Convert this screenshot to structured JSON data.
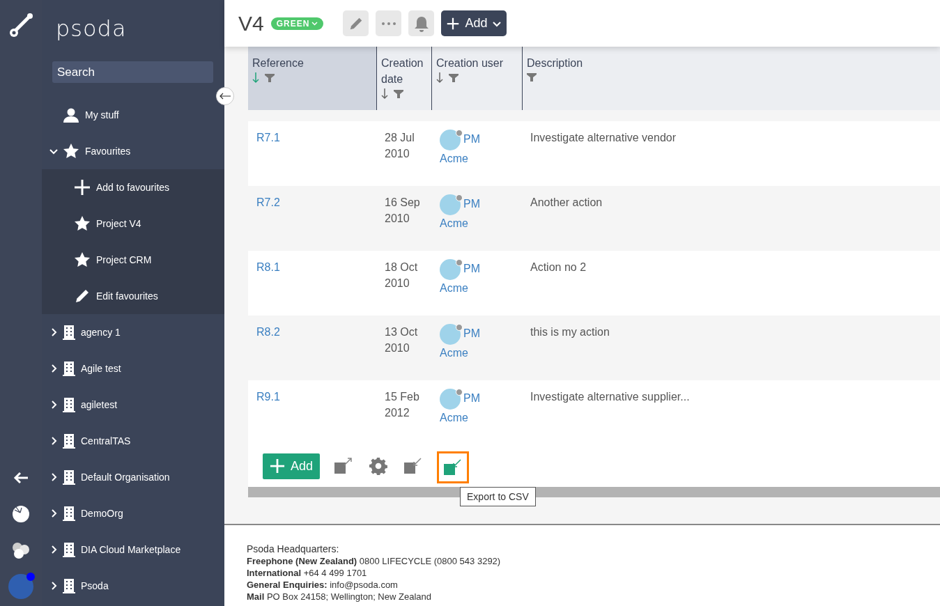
{
  "rail": {
    "notification": true
  },
  "sidebar": {
    "logo": "psoda",
    "search": {
      "placeholder": "Search"
    },
    "items": [
      {
        "label": "My stuff",
        "kind": "user"
      },
      {
        "label": "Favourites",
        "kind": "star",
        "expanded": true,
        "children": [
          {
            "label": "Add to favourites",
            "kind": "plus"
          },
          {
            "label": "Project V4",
            "kind": "star"
          },
          {
            "label": "Project CRM",
            "kind": "star"
          },
          {
            "label": "Edit favourites",
            "kind": "pencil"
          }
        ]
      },
      {
        "label": "agency 1",
        "kind": "building",
        "expanded": false
      },
      {
        "label": "Agile test",
        "kind": "building",
        "expanded": false
      },
      {
        "label": "agiletest",
        "kind": "building",
        "expanded": false
      },
      {
        "label": "CentralTAS",
        "kind": "building",
        "expanded": false
      },
      {
        "label": "Default Organisation",
        "kind": "building",
        "expanded": false
      },
      {
        "label": "DemoOrg",
        "kind": "building",
        "expanded": false
      },
      {
        "label": "DIA Cloud Marketplace",
        "kind": "building",
        "expanded": false
      },
      {
        "label": "Psoda",
        "kind": "building",
        "expanded": false
      }
    ]
  },
  "header": {
    "title": "V4",
    "status": "GREEN",
    "add": "Add"
  },
  "table": {
    "columns": [
      {
        "label": "Reference",
        "sortable": true,
        "sorted": true
      },
      {
        "label": "Creation date",
        "sortable": true,
        "sorted": false
      },
      {
        "label": "Creation user",
        "sortable": true,
        "sorted": false
      },
      {
        "label": "Description",
        "sortable": false,
        "sorted": false
      }
    ],
    "rows": [
      {
        "reference": "R7.1",
        "date": "28 Jul 2010",
        "user": "PM",
        "org": "Acme",
        "description": "Investigate alternative vendor"
      },
      {
        "reference": "R7.2",
        "date": "16 Sep 2010",
        "user": "PM",
        "org": "Acme",
        "description": "Another action"
      },
      {
        "reference": "R8.1",
        "date": "18 Oct 2010",
        "user": "PM",
        "org": "Acme",
        "description": "Action no 2"
      },
      {
        "reference": "R8.2",
        "date": "13 Oct 2010",
        "user": "PM",
        "org": "Acme",
        "description": "this is my action"
      },
      {
        "reference": "R9.1",
        "date": "15 Feb 2012",
        "user": "PM",
        "org": "Acme",
        "description": "Investigate alternative supplier..."
      }
    ]
  },
  "toolbar": {
    "add": "Add",
    "tools": [
      {
        "kind": "csv-import",
        "selected": false
      },
      {
        "kind": "settings",
        "selected": false
      },
      {
        "kind": "excel-import",
        "selected": false
      },
      {
        "kind": "csv-export",
        "selected": true,
        "tooltip": "Export to CSV"
      }
    ]
  },
  "footer": {
    "title": "Psoda Headquarters:",
    "lines": [
      "**Freephone (New Zealand)** 0800 LIFECYCLE (0800 543 3292)",
      "**International** +64 4 499 1701",
      "**General Enquiries:** info@psoda.com",
      "**Mail** PO Box 24158; Wellington; New Zealand"
    ]
  }
}
